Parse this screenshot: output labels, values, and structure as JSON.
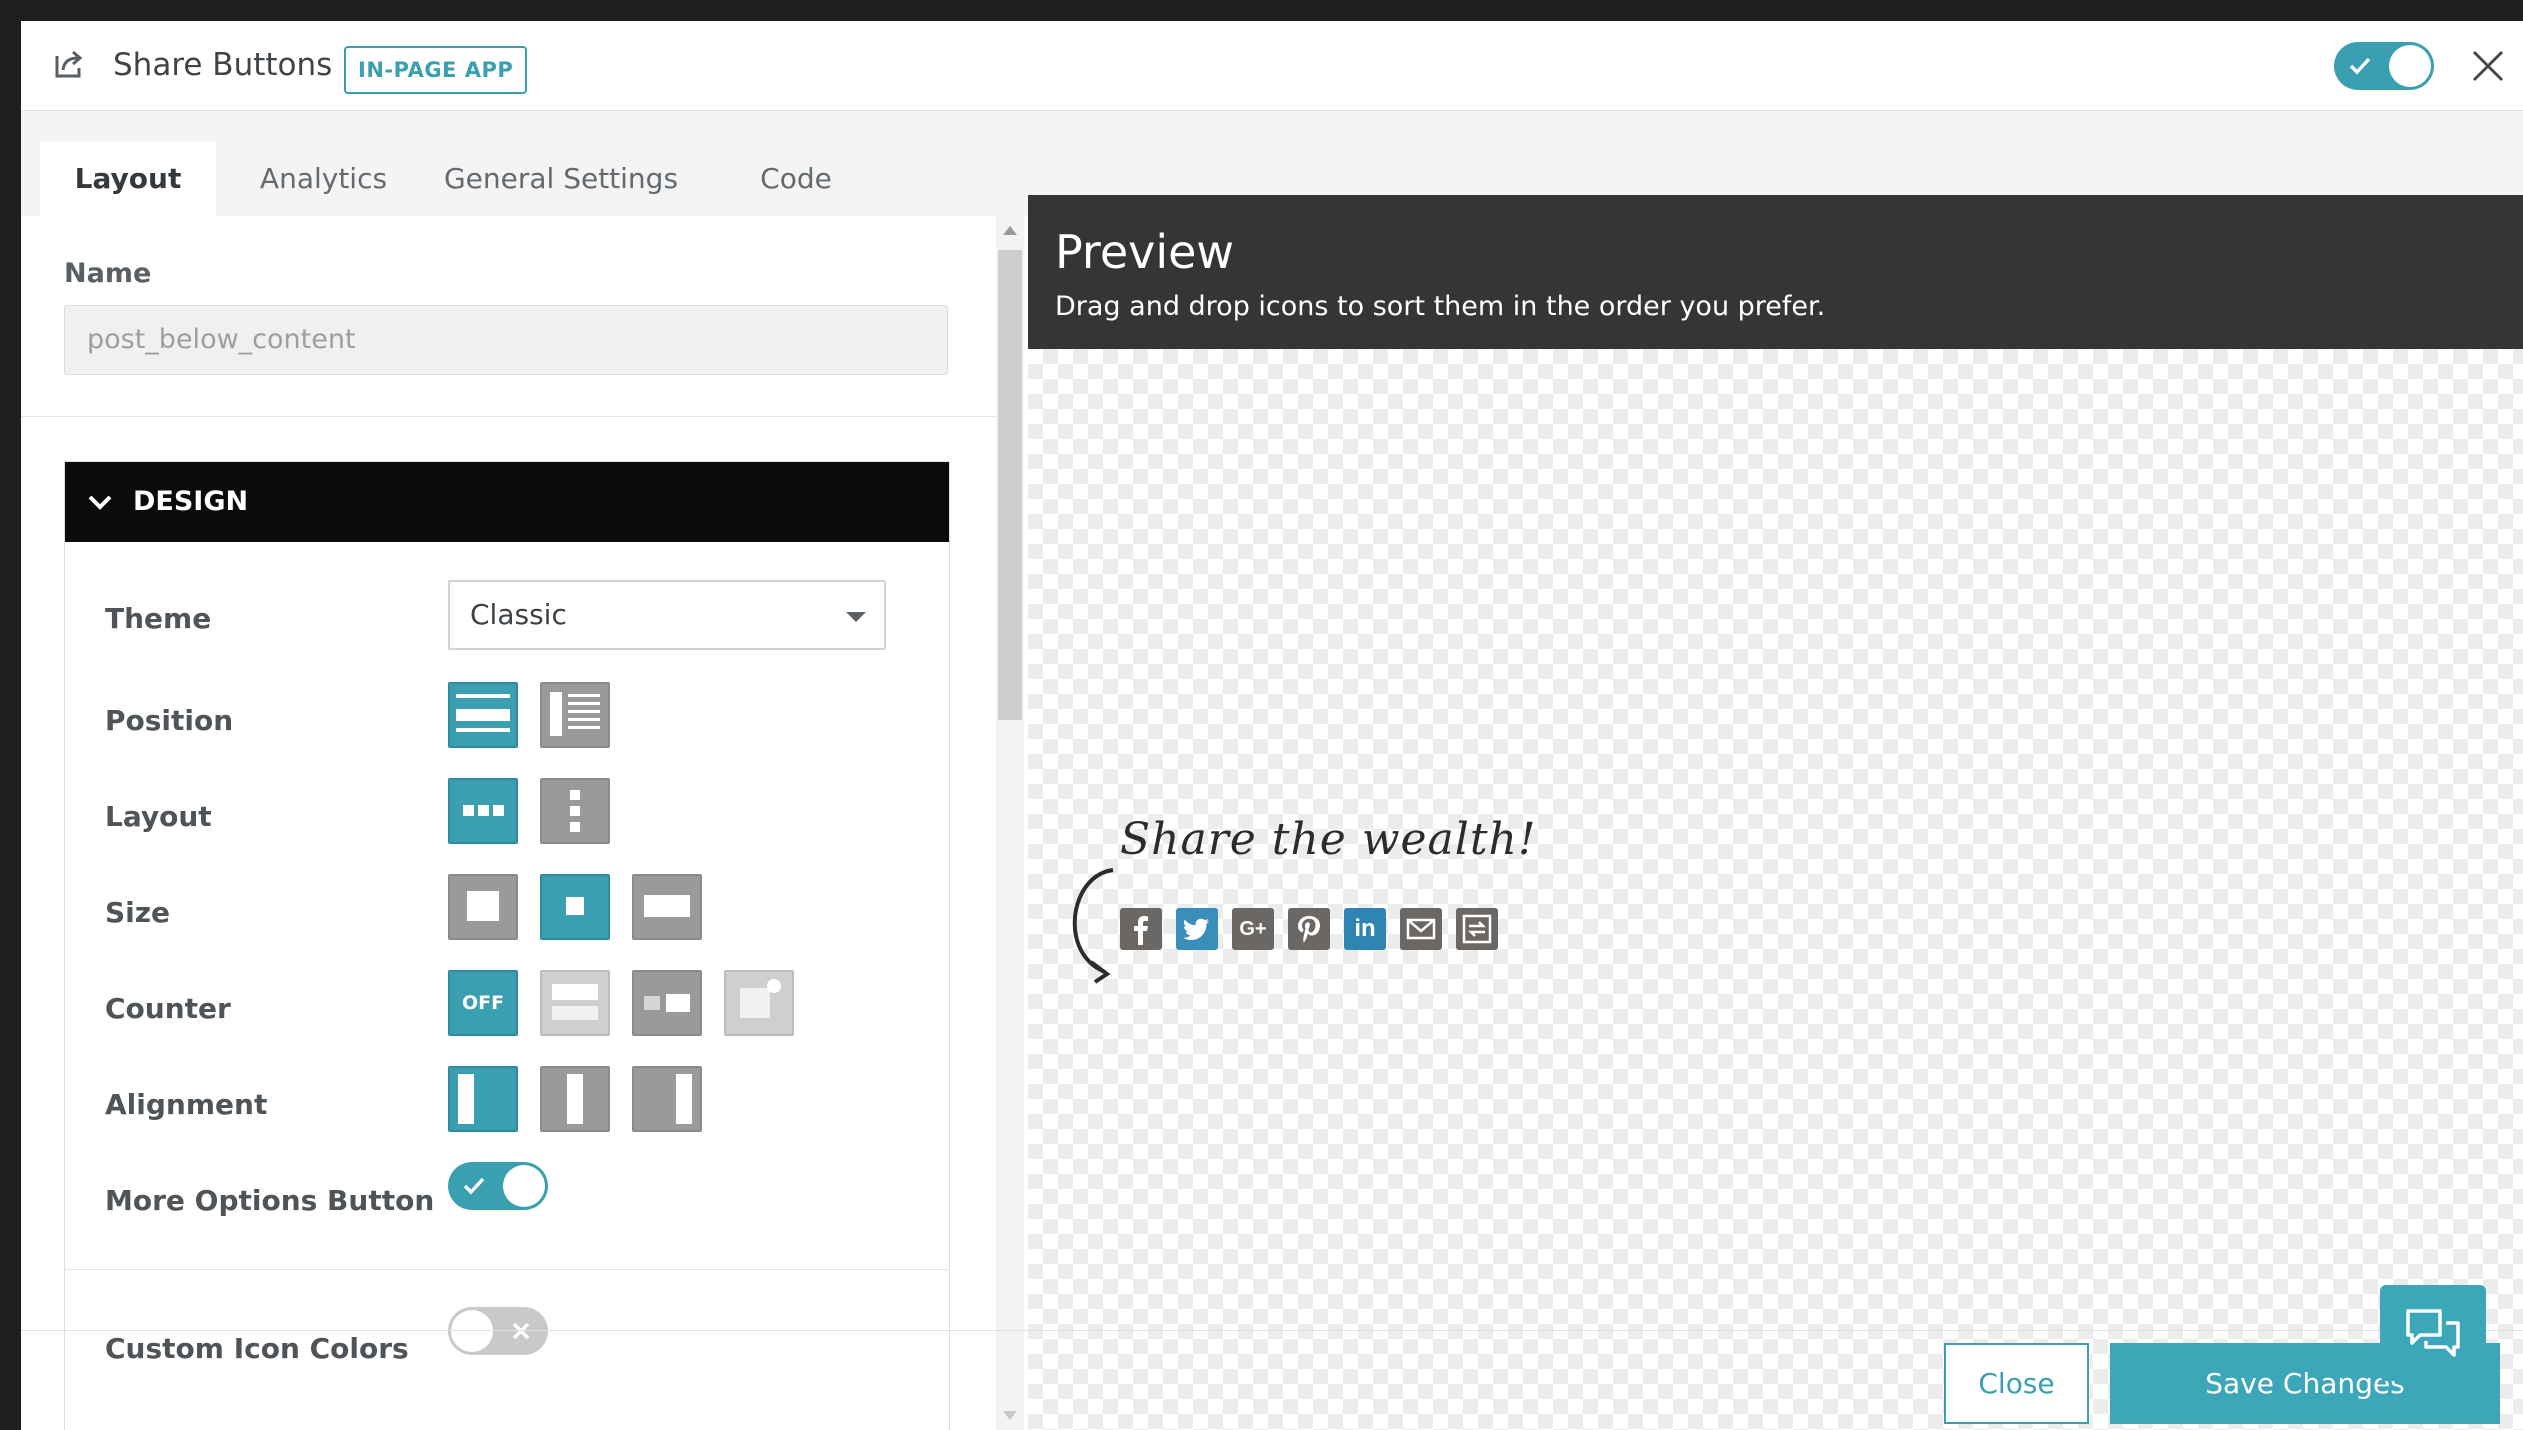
{
  "header": {
    "title": "Share Buttons",
    "badge": "IN-PAGE APP",
    "enabled": true
  },
  "tabs": [
    {
      "label": "Layout",
      "active": true
    },
    {
      "label": "Analytics",
      "active": false
    },
    {
      "label": "General Settings",
      "active": false
    },
    {
      "label": "Code",
      "active": false
    }
  ],
  "form": {
    "name_label": "Name",
    "name_value": "post_below_content",
    "design": {
      "heading": "DESIGN",
      "theme_label": "Theme",
      "theme_value": "Classic",
      "position_label": "Position",
      "layout_label": "Layout",
      "size_label": "Size",
      "counter_label": "Counter",
      "counter_off_text": "OFF",
      "alignment_label": "Alignment",
      "more_options_label": "More Options Button",
      "more_options_enabled": true,
      "custom_icon_colors_label": "Custom Icon Colors",
      "custom_icon_colors_enabled": false
    }
  },
  "preview": {
    "title": "Preview",
    "subtitle": "Drag and drop icons to sort them in the order you prefer.",
    "share_heading": "Share the wealth!",
    "icons": [
      "facebook-icon",
      "twitter-icon",
      "google-plus-icon",
      "pinterest-icon",
      "linkedin-icon",
      "email-icon",
      "more-options-icon"
    ],
    "gplus_text": "G+",
    "linkedin_text": "in"
  },
  "footer": {
    "close_label": "Close",
    "save_label": "Save Changes"
  },
  "colors": {
    "accent": "#3a9fb0",
    "header_dark": "#343535",
    "design_bar": "#0b0b0b"
  }
}
